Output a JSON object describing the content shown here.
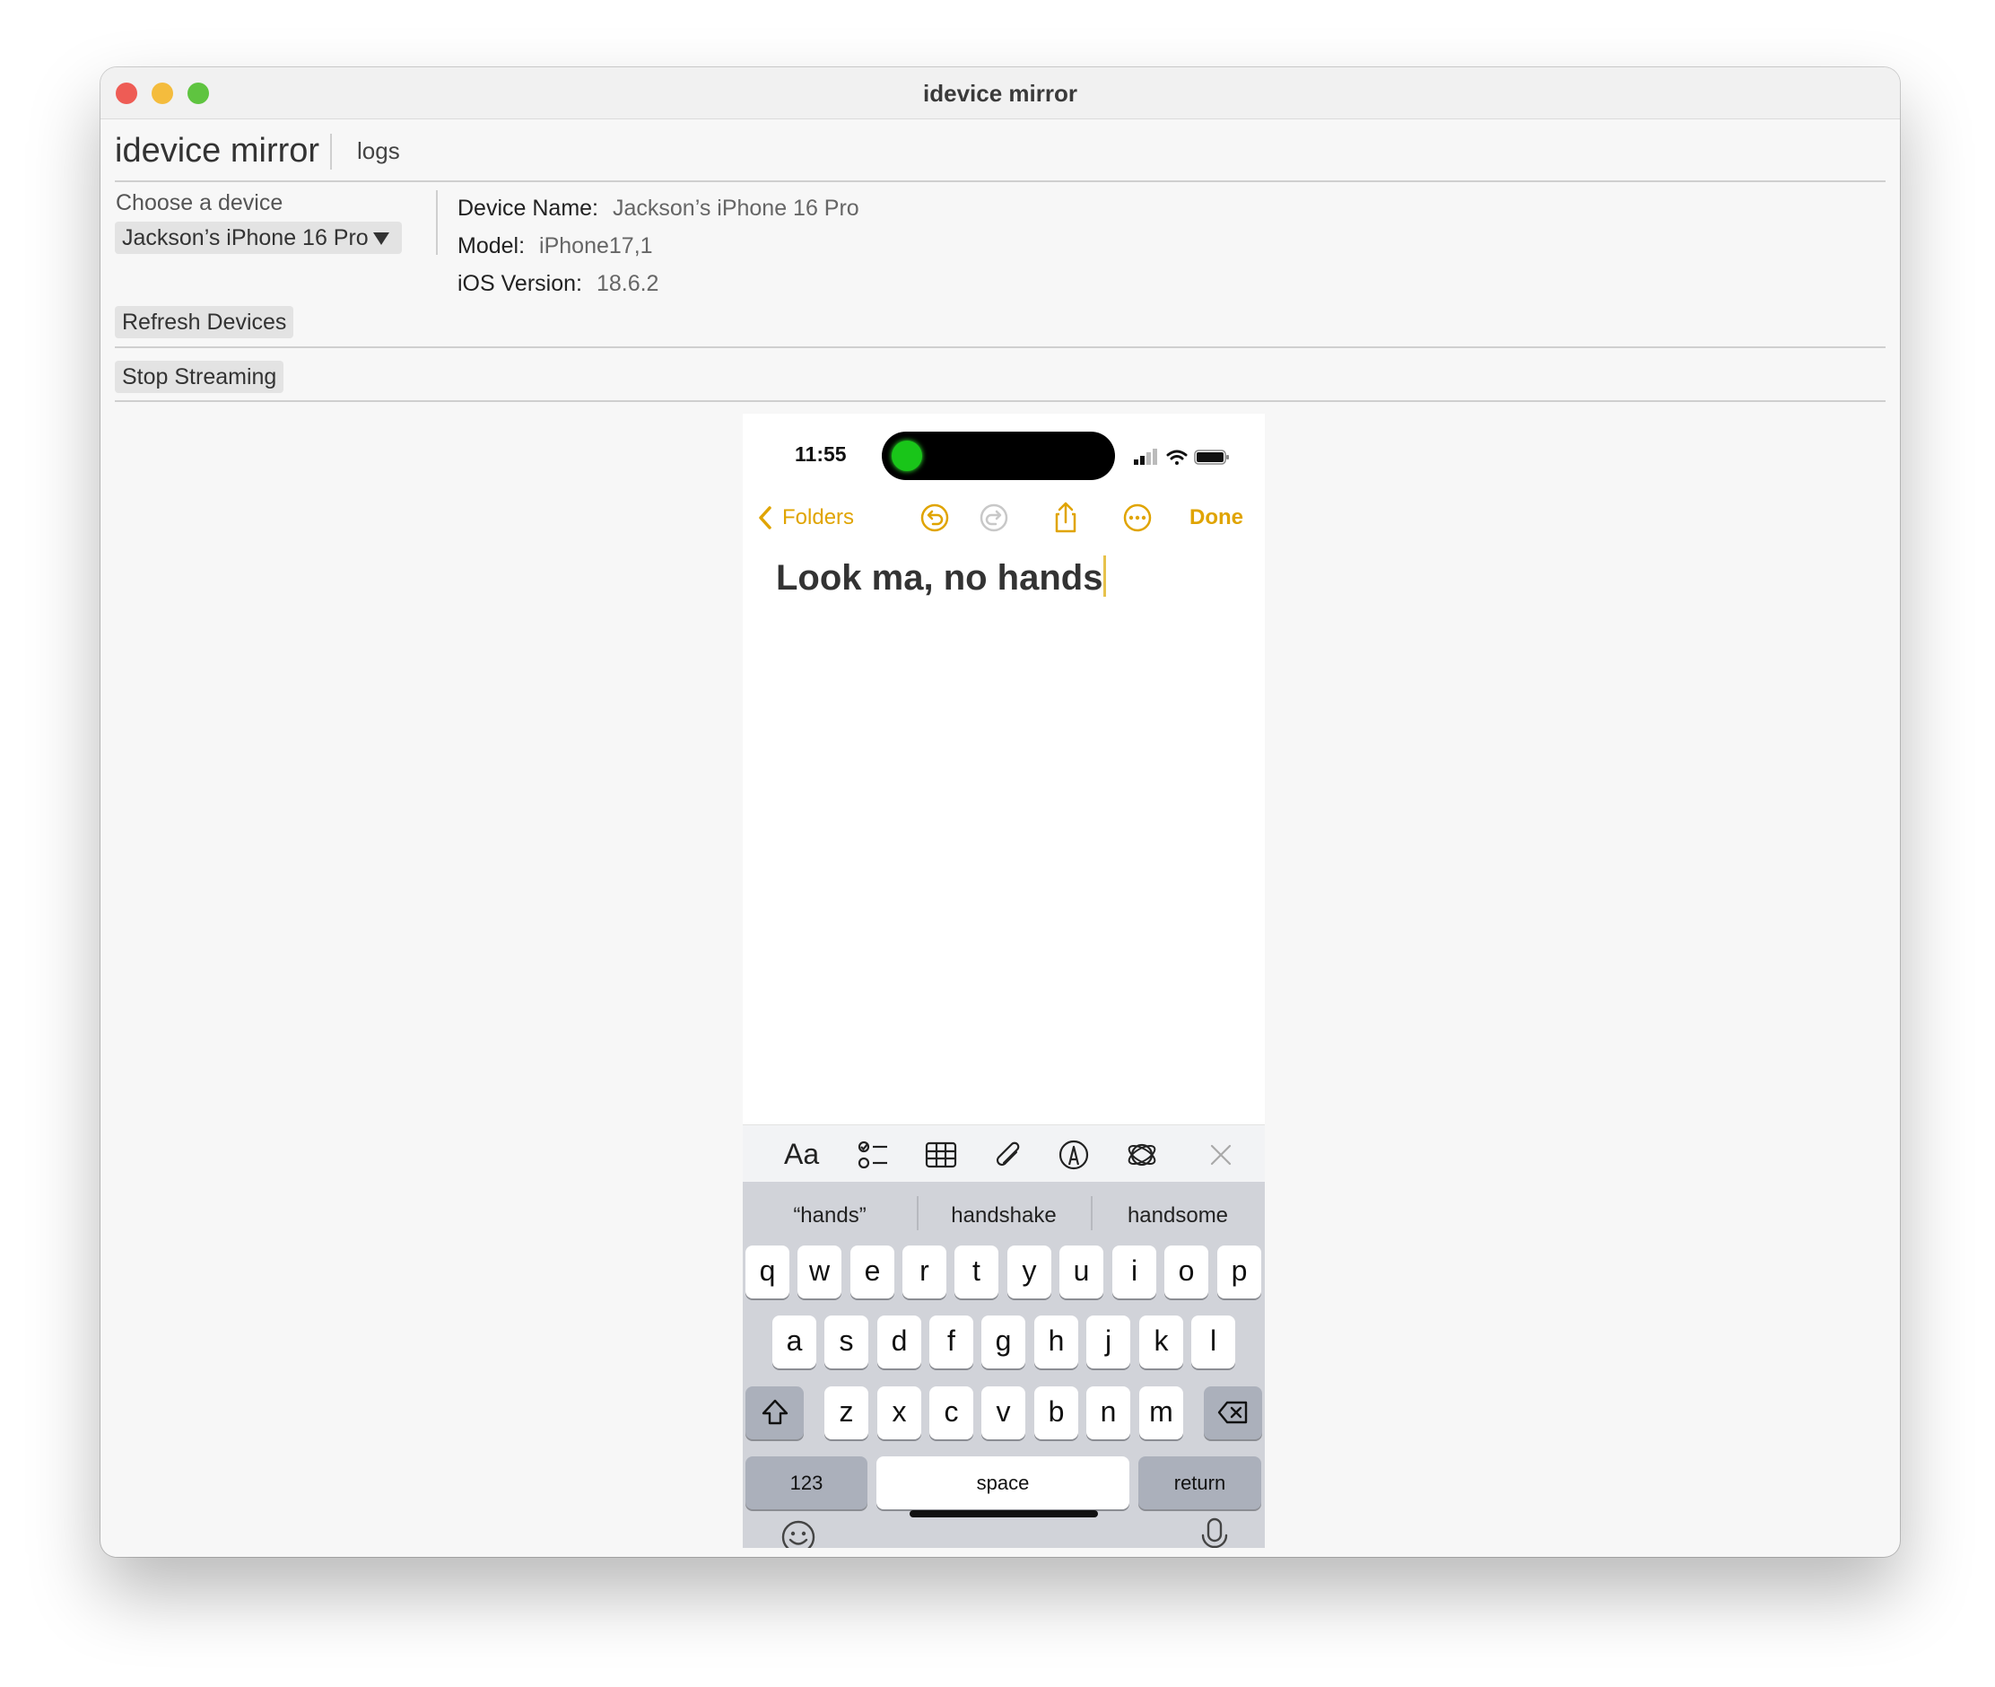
{
  "window": {
    "title": "idevice mirror",
    "traffic_lights": [
      "close",
      "minimize",
      "zoom"
    ]
  },
  "app": {
    "title": "idevice mirror",
    "logs_tab": "logs"
  },
  "device_panel": {
    "choose_label": "Choose a device",
    "selected_device": "Jackson’s iPhone 16 Pro",
    "refresh_button": "Refresh Devices",
    "device_name_label": "Device Name:",
    "device_name": "Jackson’s iPhone 16 Pro",
    "model_label": "Model:",
    "model": "iPhone17,1",
    "ios_label": "iOS Version:",
    "ios_version": "18.6.2"
  },
  "stream": {
    "stop_button": "Stop Streaming"
  },
  "phone": {
    "status": {
      "time": "11:55"
    },
    "nav": {
      "back_label": "Folders",
      "done_label": "Done",
      "icons": [
        "undo-icon",
        "redo-icon",
        "share-icon",
        "more-icon"
      ]
    },
    "note_title": "Look ma, no hands",
    "format_bar": {
      "aa_label": "Aa",
      "icons": [
        "checklist-icon",
        "table-icon",
        "attachment-icon",
        "markup-icon",
        "writing-tools-icon",
        "close-icon"
      ]
    },
    "keyboard": {
      "suggestions": [
        "“hands”",
        "handshake",
        "handsome"
      ],
      "row1": [
        "q",
        "w",
        "e",
        "r",
        "t",
        "y",
        "u",
        "i",
        "o",
        "p"
      ],
      "row2": [
        "a",
        "s",
        "d",
        "f",
        "g",
        "h",
        "j",
        "k",
        "l"
      ],
      "row3": [
        "z",
        "x",
        "c",
        "v",
        "b",
        "n",
        "m"
      ],
      "numbers_key": "123",
      "space_key": "space",
      "return_key": "return",
      "bottom_icons": [
        "emoji-icon",
        "microphone-icon"
      ]
    },
    "accent_color": "#e0a400"
  }
}
